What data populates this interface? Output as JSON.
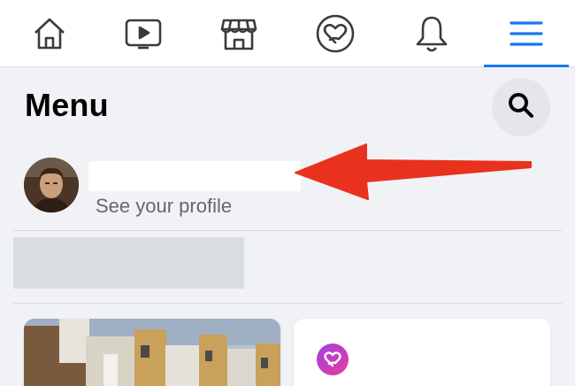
{
  "nav": {
    "items": [
      {
        "icon": "home-icon"
      },
      {
        "icon": "video-icon"
      },
      {
        "icon": "marketplace-icon"
      },
      {
        "icon": "dating-heart-icon"
      },
      {
        "icon": "notifications-bell-icon"
      },
      {
        "icon": "menu-hamburger-icon",
        "active": true
      }
    ],
    "active_color": "#1877f2"
  },
  "header": {
    "title": "Menu"
  },
  "profile": {
    "subtitle": "See your profile"
  },
  "colors": {
    "background": "#f0f2f5",
    "annotation_arrow": "#e8321e"
  }
}
